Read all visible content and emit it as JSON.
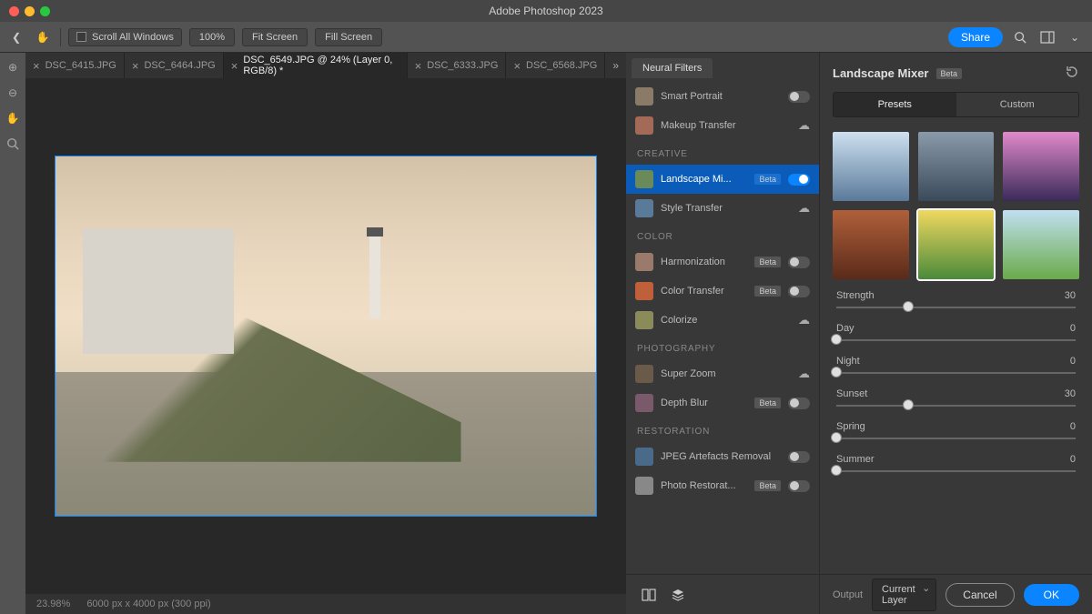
{
  "window_title": "Adobe Photoshop 2023",
  "toolbar": {
    "scroll_all_label": "Scroll All Windows",
    "zoom_label": "100%",
    "fit_screen_label": "Fit Screen",
    "fill_screen_label": "Fill Screen",
    "share_label": "Share"
  },
  "tabs": [
    {
      "label": "DSC_6415.JPG",
      "active": false
    },
    {
      "label": "DSC_6464.JPG",
      "active": false
    },
    {
      "label": "DSC_6549.JPG @ 24% (Layer 0, RGB/8) *",
      "active": true
    },
    {
      "label": "DSC_6333.JPG",
      "active": false
    },
    {
      "label": "DSC_6568.JPG",
      "active": false
    }
  ],
  "status": {
    "zoom": "23.98%",
    "dims": "6000 px x 4000 px (300 ppi)"
  },
  "neural_panel": {
    "title": "Neural Filters",
    "categories": [
      {
        "name": "",
        "items": [
          {
            "label": "Smart Portrait",
            "control": "toggle",
            "on": false,
            "thumb": "#8a7a68"
          },
          {
            "label": "Makeup Transfer",
            "control": "download",
            "thumb": "#a46a58"
          }
        ]
      },
      {
        "name": "CREATIVE",
        "items": [
          {
            "label": "Landscape Mi...",
            "control": "toggle",
            "on": true,
            "beta": "Beta",
            "active": true,
            "thumb": "#6a8a5a"
          },
          {
            "label": "Style Transfer",
            "control": "download",
            "thumb": "#5a7a9a"
          }
        ]
      },
      {
        "name": "COLOR",
        "items": [
          {
            "label": "Harmonization",
            "control": "toggle",
            "on": false,
            "beta": "Beta",
            "thumb": "#9a7a6a"
          },
          {
            "label": "Color Transfer",
            "control": "toggle",
            "on": false,
            "beta": "Beta",
            "thumb": "#c0603a"
          },
          {
            "label": "Colorize",
            "control": "download",
            "thumb": "#8a8a5a"
          }
        ]
      },
      {
        "name": "PHOTOGRAPHY",
        "items": [
          {
            "label": "Super Zoom",
            "control": "download",
            "thumb": "#6a5a4a"
          },
          {
            "label": "Depth Blur",
            "control": "toggle",
            "on": false,
            "beta": "Beta",
            "thumb": "#7a5a6a"
          }
        ]
      },
      {
        "name": "RESTORATION",
        "items": [
          {
            "label": "JPEG Artefacts Removal",
            "control": "toggle",
            "on": false,
            "thumb": "#4a6a8a"
          },
          {
            "label": "Photo Restorat...",
            "control": "toggle",
            "on": false,
            "beta": "Beta",
            "thumb": "#888"
          }
        ]
      }
    ]
  },
  "mixer": {
    "title": "Landscape Mixer",
    "beta": "Beta",
    "seg": {
      "presets": "Presets",
      "custom": "Custom"
    },
    "presets": [
      {
        "bg": "linear-gradient(#cde0f0,#5a7a9a)"
      },
      {
        "bg": "linear-gradient(#8a9aaa,#3a4a5a)"
      },
      {
        "bg": "linear-gradient(#e08aca,#3a2a5a)"
      },
      {
        "bg": "linear-gradient(#b0603a,#5a2a1a)"
      },
      {
        "bg": "linear-gradient(#f0d860,#4a8a3a)",
        "selected": true
      },
      {
        "bg": "linear-gradient(#c0e0f0,#6aaa4a)"
      }
    ],
    "sliders": [
      {
        "name": "Strength",
        "value": 30,
        "pct": 30
      },
      {
        "name": "Day",
        "value": 0,
        "pct": 0
      },
      {
        "name": "Night",
        "value": 0,
        "pct": 0
      },
      {
        "name": "Sunset",
        "value": 30,
        "pct": 30
      },
      {
        "name": "Spring",
        "value": 0,
        "pct": 0
      },
      {
        "name": "Summer",
        "value": 0,
        "pct": 0
      }
    ]
  },
  "footer": {
    "output_label": "Output",
    "output_value": "Current Layer",
    "cancel": "Cancel",
    "ok": "OK"
  }
}
